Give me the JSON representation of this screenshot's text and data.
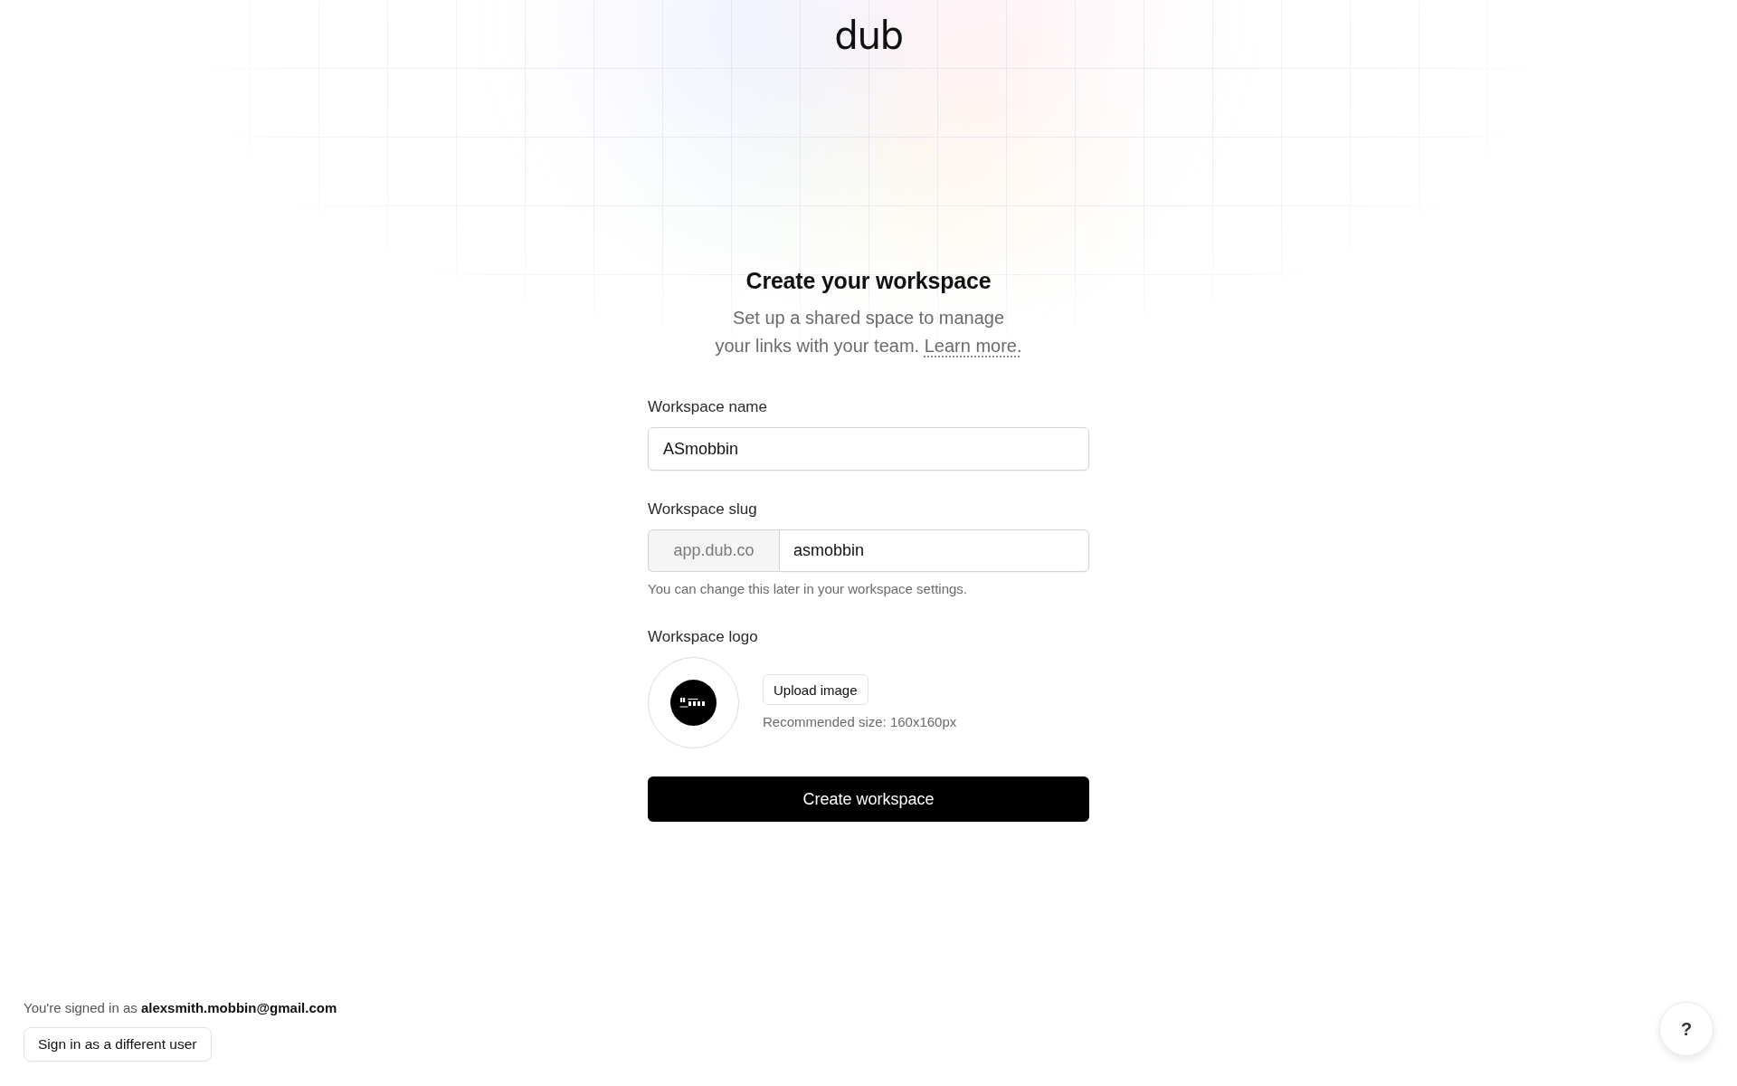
{
  "brand": {
    "name": "dub"
  },
  "heading": "Create your workspace",
  "intro": {
    "text": "Set up a shared space to manage your links with your team.",
    "link": "Learn more."
  },
  "form": {
    "fields": [
      {
        "kind": "text",
        "label": "Workspace name",
        "value": "ASmobbin"
      },
      {
        "kind": "prefixed",
        "label": "Workspace slug",
        "prefix": "app.dub.co",
        "value": "asmobbin",
        "help": "You can change this later in your workspace settings."
      },
      {
        "kind": "logo",
        "label": "Workspace logo",
        "button": "Upload image",
        "note": "Recommended size: 160x160px"
      }
    ],
    "submit": "Create workspace"
  },
  "account": {
    "signed_in_text": "You're signed in as **alexsmith.mobbin@gmail.com**",
    "button": "Sign in as a different user"
  },
  "help_button": {
    "label": "?"
  }
}
